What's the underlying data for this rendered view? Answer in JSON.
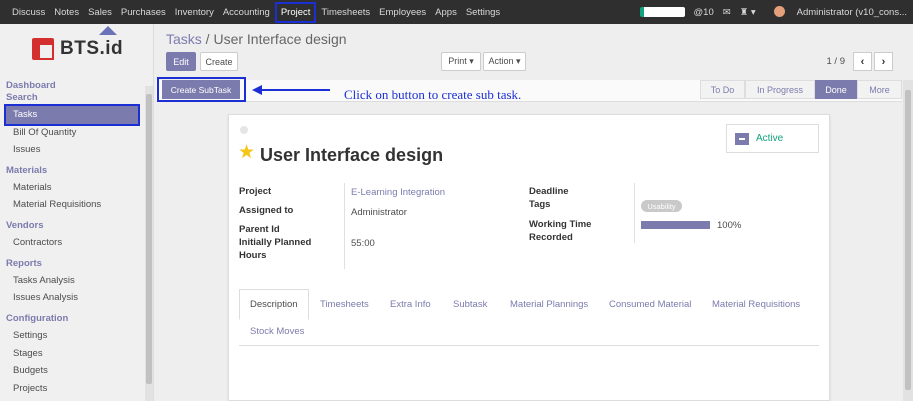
{
  "topbar": {
    "menu": [
      "Discuss",
      "Notes",
      "Sales",
      "Purchases",
      "Inventory",
      "Accounting",
      "Project",
      "Timesheets",
      "Employees",
      "Apps",
      "Settings"
    ],
    "active_menu": "Project",
    "mentions": "@10",
    "user": "Administrator (v10_cons..."
  },
  "sidebar": {
    "logo_text": "BTS.id",
    "sections": {
      "dashboard": "Dashboard",
      "search": "Search",
      "materials": "Materials",
      "vendors": "Vendors",
      "reports": "Reports",
      "configuration": "Configuration"
    },
    "items": {
      "tasks": "Tasks",
      "bom": "Bill Of Quantity",
      "issues": "Issues",
      "materials": "Materials",
      "material_requisitions": "Material Requisitions",
      "contractors": "Contractors",
      "tasks_analysis": "Tasks Analysis",
      "issues_analysis": "Issues Analysis",
      "settings": "Settings",
      "stages": "Stages",
      "budgets": "Budgets",
      "projects": "Projects"
    }
  },
  "header": {
    "breadcrumb_parent": "Tasks",
    "breadcrumb_sep": " / ",
    "breadcrumb_current": "User Interface design",
    "edit": "Edit",
    "create": "Create",
    "print": "Print ▾",
    "action": "Action ▾",
    "pager": "1 / 9"
  },
  "statusbar": {
    "create_subtask": "Create SubTask",
    "annotation": "Click on button to create sub task.",
    "stages": [
      "To Do",
      "In Progress",
      "Done",
      "More"
    ],
    "current_stage": "Done"
  },
  "record": {
    "status": "Active",
    "title": "User Interface design",
    "fields": {
      "project_label": "Project",
      "project_value": "E-Learning Integration",
      "assigned_label": "Assigned to",
      "assigned_value": "Administrator",
      "parent_label": "Parent Id",
      "planned_label": "Initially Planned Hours",
      "planned_value": "55:00",
      "deadline_label": "Deadline",
      "tags_label": "Tags",
      "tag_value": "Usability",
      "worktime_label": "Working Time Recorded",
      "worktime_value": "100%",
      "worktime_fraction": 1.0
    },
    "tabs": [
      "Description",
      "Timesheets",
      "Extra Info",
      "Subtask",
      "Material Plannings",
      "Consumed Material",
      "Material Requisitions",
      "Stock Moves"
    ]
  },
  "colors": {
    "accent": "#7c7bad",
    "annotation": "#1b2fd4",
    "active_status": "#10a37f",
    "star": "#f5c518"
  }
}
